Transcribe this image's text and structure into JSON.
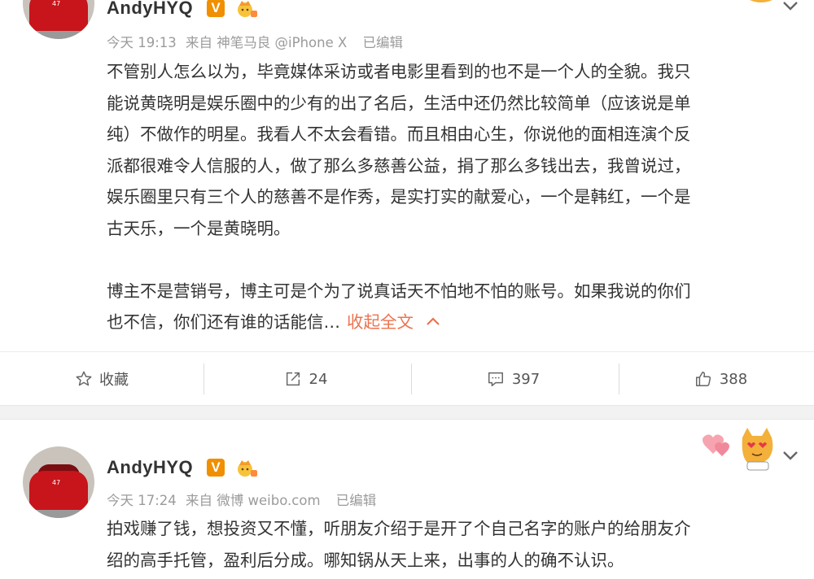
{
  "posts": [
    {
      "author": "AndyHYQ",
      "badge": "V",
      "time": "今天 19:13",
      "source": "来自 神笔马良 @iPhone X",
      "edited": "已编辑",
      "paragraphs": [
        [
          "不管别人怎么以为，毕竟媒体采访或者电影里看到的也不是一个人的全貌。我只",
          "能说黄晓明是娱乐圈中的少有的出了名后，生活中还仍然比较简单（应该说是单",
          "纯）不做作的明星。我看人不太会看错。而且相由心生，你说他的面相连演个反",
          "派都很难令人信服的人，做了那么多慈善公益，捐了那么多钱出去，我曾说过，",
          "娱乐圈里只有三个人的慈善不是作秀，是实打实的献爱心，一个是韩红，一个是",
          "古天乐，一个是黄晓明。"
        ],
        [
          "博主不是营销号，博主可是个为了说真话天不怕地不怕的账号。如果我说的你们",
          "也不信，你们还有谁的话能信…"
        ]
      ],
      "collapse_label": "收起全文",
      "actions": {
        "favorite_label": "收藏",
        "repost_count": "24",
        "comment_count": "397",
        "like_count": "388"
      }
    },
    {
      "author": "AndyHYQ",
      "badge": "V",
      "time": "今天 17:24",
      "source": "来自 微博 weibo.com",
      "edited": "已编辑",
      "lines": [
        "拍戏赚了钱，想投资又不懂，听朋友介绍于是开了个自己名字的账户的给朋友介",
        "绍的高手托管，盈利后分成。哪知锅从天上来，出事的人的确不认识。"
      ]
    }
  ],
  "colors": {
    "accent": "#eb7350",
    "badge": "#f08f00",
    "meta": "#9b9b9b",
    "text": "#333333"
  },
  "icons": [
    "star-icon",
    "repost-icon",
    "comment-icon",
    "like-icon",
    "chevron-up-icon",
    "chevron-down-icon",
    "crown-icon",
    "cat-emoji-icon"
  ]
}
